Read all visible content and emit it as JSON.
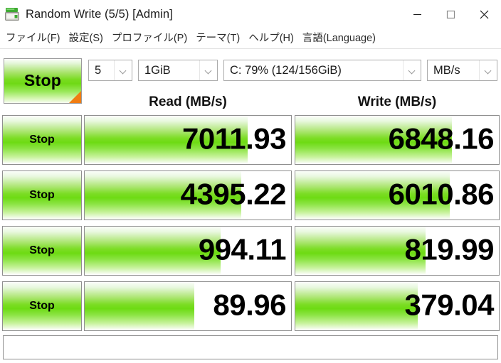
{
  "window": {
    "title": "Random Write (5/5) [Admin]",
    "icon": "disk-drive-icon",
    "minimize_label": "—",
    "maximize_label": "□",
    "close_label": "✕"
  },
  "menubar": {
    "items": [
      {
        "label": "ファイル(F)"
      },
      {
        "label": "設定(S)"
      },
      {
        "label": "プロファイル(P)"
      },
      {
        "label": "テーマ(T)"
      },
      {
        "label": "ヘルプ(H)"
      },
      {
        "label": "言語(Language)"
      }
    ]
  },
  "toolbar": {
    "stop_all_label": "Stop",
    "loops": "5",
    "test_size": "1GiB",
    "drive": "C: 79% (124/156GiB)",
    "unit": "MB/s"
  },
  "headers": {
    "read": "Read (MB/s)",
    "write": "Write (MB/s)"
  },
  "colors": {
    "bar_green": "#6ddb13",
    "accent_orange": "#f07c12",
    "border_gray": "#8f8f8f"
  },
  "rows": [
    {
      "stop_label": "Stop",
      "read_value": "7011.93",
      "read_pct": 79,
      "write_value": "6848.16",
      "write_pct": 77
    },
    {
      "stop_label": "Stop",
      "read_value": "4395.22",
      "read_pct": 76,
      "write_value": "6010.86",
      "write_pct": 76
    },
    {
      "stop_label": "Stop",
      "read_value": "994.11",
      "read_pct": 66,
      "write_value": "819.99",
      "write_pct": 64
    },
    {
      "stop_label": "Stop",
      "read_value": "89.96",
      "read_pct": 53,
      "write_value": "379.04",
      "write_pct": 60
    }
  ],
  "statusbar": {
    "text": ""
  }
}
